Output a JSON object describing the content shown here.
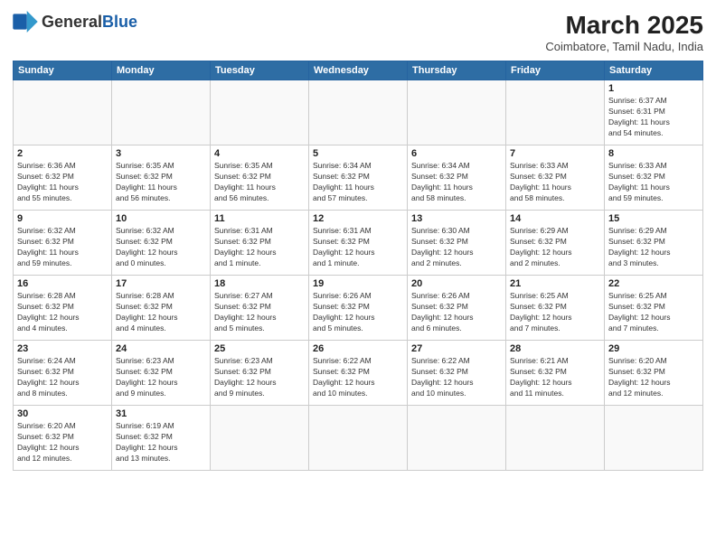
{
  "header": {
    "logo_general": "General",
    "logo_blue": "Blue",
    "month_year": "March 2025",
    "location": "Coimbatore, Tamil Nadu, India"
  },
  "weekdays": [
    "Sunday",
    "Monday",
    "Tuesday",
    "Wednesday",
    "Thursday",
    "Friday",
    "Saturday"
  ],
  "weeks": [
    [
      {
        "day": "",
        "info": ""
      },
      {
        "day": "",
        "info": ""
      },
      {
        "day": "",
        "info": ""
      },
      {
        "day": "",
        "info": ""
      },
      {
        "day": "",
        "info": ""
      },
      {
        "day": "",
        "info": ""
      },
      {
        "day": "1",
        "info": "Sunrise: 6:37 AM\nSunset: 6:31 PM\nDaylight: 11 hours\nand 54 minutes."
      }
    ],
    [
      {
        "day": "2",
        "info": "Sunrise: 6:36 AM\nSunset: 6:32 PM\nDaylight: 11 hours\nand 55 minutes."
      },
      {
        "day": "3",
        "info": "Sunrise: 6:35 AM\nSunset: 6:32 PM\nDaylight: 11 hours\nand 56 minutes."
      },
      {
        "day": "4",
        "info": "Sunrise: 6:35 AM\nSunset: 6:32 PM\nDaylight: 11 hours\nand 56 minutes."
      },
      {
        "day": "5",
        "info": "Sunrise: 6:34 AM\nSunset: 6:32 PM\nDaylight: 11 hours\nand 57 minutes."
      },
      {
        "day": "6",
        "info": "Sunrise: 6:34 AM\nSunset: 6:32 PM\nDaylight: 11 hours\nand 58 minutes."
      },
      {
        "day": "7",
        "info": "Sunrise: 6:33 AM\nSunset: 6:32 PM\nDaylight: 11 hours\nand 58 minutes."
      },
      {
        "day": "8",
        "info": "Sunrise: 6:33 AM\nSunset: 6:32 PM\nDaylight: 11 hours\nand 59 minutes."
      }
    ],
    [
      {
        "day": "9",
        "info": "Sunrise: 6:32 AM\nSunset: 6:32 PM\nDaylight: 11 hours\nand 59 minutes."
      },
      {
        "day": "10",
        "info": "Sunrise: 6:32 AM\nSunset: 6:32 PM\nDaylight: 12 hours\nand 0 minutes."
      },
      {
        "day": "11",
        "info": "Sunrise: 6:31 AM\nSunset: 6:32 PM\nDaylight: 12 hours\nand 1 minute."
      },
      {
        "day": "12",
        "info": "Sunrise: 6:31 AM\nSunset: 6:32 PM\nDaylight: 12 hours\nand 1 minute."
      },
      {
        "day": "13",
        "info": "Sunrise: 6:30 AM\nSunset: 6:32 PM\nDaylight: 12 hours\nand 2 minutes."
      },
      {
        "day": "14",
        "info": "Sunrise: 6:29 AM\nSunset: 6:32 PM\nDaylight: 12 hours\nand 2 minutes."
      },
      {
        "day": "15",
        "info": "Sunrise: 6:29 AM\nSunset: 6:32 PM\nDaylight: 12 hours\nand 3 minutes."
      }
    ],
    [
      {
        "day": "16",
        "info": "Sunrise: 6:28 AM\nSunset: 6:32 PM\nDaylight: 12 hours\nand 4 minutes."
      },
      {
        "day": "17",
        "info": "Sunrise: 6:28 AM\nSunset: 6:32 PM\nDaylight: 12 hours\nand 4 minutes."
      },
      {
        "day": "18",
        "info": "Sunrise: 6:27 AM\nSunset: 6:32 PM\nDaylight: 12 hours\nand 5 minutes."
      },
      {
        "day": "19",
        "info": "Sunrise: 6:26 AM\nSunset: 6:32 PM\nDaylight: 12 hours\nand 5 minutes."
      },
      {
        "day": "20",
        "info": "Sunrise: 6:26 AM\nSunset: 6:32 PM\nDaylight: 12 hours\nand 6 minutes."
      },
      {
        "day": "21",
        "info": "Sunrise: 6:25 AM\nSunset: 6:32 PM\nDaylight: 12 hours\nand 7 minutes."
      },
      {
        "day": "22",
        "info": "Sunrise: 6:25 AM\nSunset: 6:32 PM\nDaylight: 12 hours\nand 7 minutes."
      }
    ],
    [
      {
        "day": "23",
        "info": "Sunrise: 6:24 AM\nSunset: 6:32 PM\nDaylight: 12 hours\nand 8 minutes."
      },
      {
        "day": "24",
        "info": "Sunrise: 6:23 AM\nSunset: 6:32 PM\nDaylight: 12 hours\nand 9 minutes."
      },
      {
        "day": "25",
        "info": "Sunrise: 6:23 AM\nSunset: 6:32 PM\nDaylight: 12 hours\nand 9 minutes."
      },
      {
        "day": "26",
        "info": "Sunrise: 6:22 AM\nSunset: 6:32 PM\nDaylight: 12 hours\nand 10 minutes."
      },
      {
        "day": "27",
        "info": "Sunrise: 6:22 AM\nSunset: 6:32 PM\nDaylight: 12 hours\nand 10 minutes."
      },
      {
        "day": "28",
        "info": "Sunrise: 6:21 AM\nSunset: 6:32 PM\nDaylight: 12 hours\nand 11 minutes."
      },
      {
        "day": "29",
        "info": "Sunrise: 6:20 AM\nSunset: 6:32 PM\nDaylight: 12 hours\nand 12 minutes."
      }
    ],
    [
      {
        "day": "30",
        "info": "Sunrise: 6:20 AM\nSunset: 6:32 PM\nDaylight: 12 hours\nand 12 minutes."
      },
      {
        "day": "31",
        "info": "Sunrise: 6:19 AM\nSunset: 6:32 PM\nDaylight: 12 hours\nand 13 minutes."
      },
      {
        "day": "",
        "info": ""
      },
      {
        "day": "",
        "info": ""
      },
      {
        "day": "",
        "info": ""
      },
      {
        "day": "",
        "info": ""
      },
      {
        "day": "",
        "info": ""
      }
    ]
  ]
}
